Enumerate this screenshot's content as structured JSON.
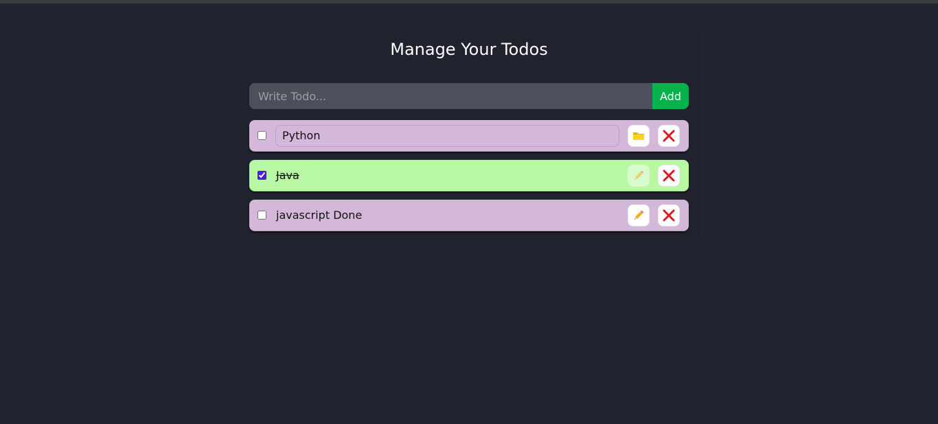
{
  "page": {
    "title": "Manage Your Todos"
  },
  "form": {
    "placeholder": "Write Todo...",
    "value": "",
    "add_label": "Add"
  },
  "todos": [
    {
      "text": "Python",
      "completed": false,
      "editing": true,
      "bg": "#d3b8d9",
      "edit_icon": "folder-icon",
      "delete_icon": "close-icon"
    },
    {
      "text": "Java",
      "completed": true,
      "editing": false,
      "bg": "#b8f8a4",
      "edit_icon": "pencil-icon",
      "delete_icon": "close-icon"
    },
    {
      "text": "javascript Done",
      "completed": false,
      "editing": false,
      "bg": "#d3b8d9",
      "edit_icon": "pencil-icon",
      "delete_icon": "close-icon"
    }
  ],
  "colors": {
    "background": "#222430",
    "add_button": "#07b14b",
    "input_bg": "#4d505a",
    "delete_icon": "#e0161e"
  }
}
